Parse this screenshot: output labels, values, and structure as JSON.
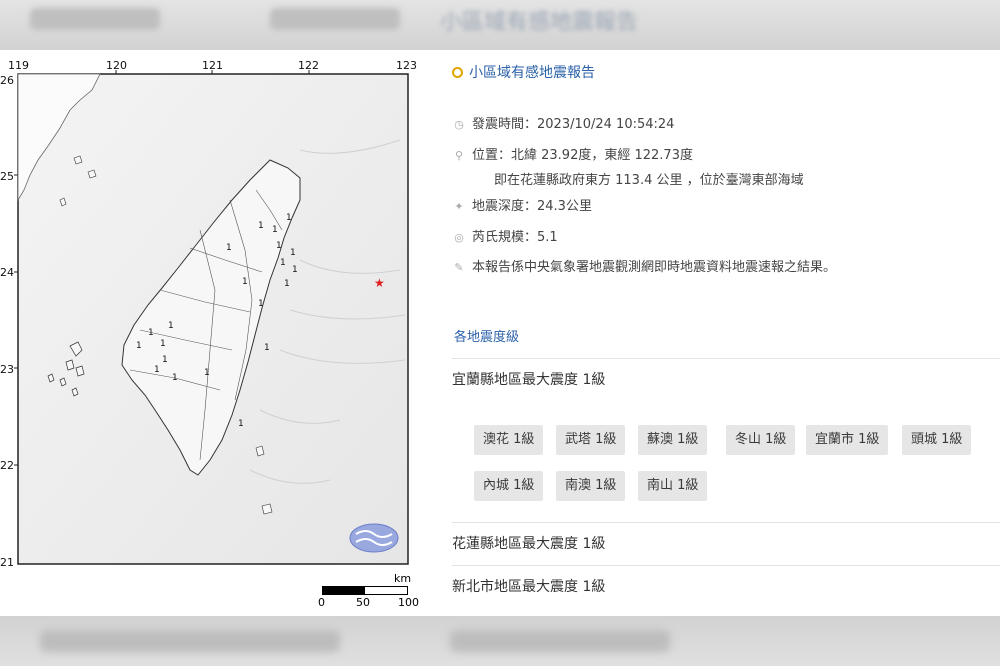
{
  "report": {
    "title": "小區域有感地震報告",
    "time": "發震時間：2023/10/24 10:54:24",
    "location": "位置：北緯 23.92度，東經 122.73度",
    "location_detail": "即在花蓮縣政府東方 113.4 公里 ，位於臺灣東部海域",
    "depth": "地震深度：24.3公里",
    "magnitude": "芮氏規模：5.1",
    "note": "本報告係中央氣象署地震觀測網即時地震資料地震速報之結果。",
    "section_label": "各地震度級",
    "regions": [
      {
        "label": "宜蘭縣地區最大震度 1級",
        "stations": [
          "澳花 1級",
          "武塔 1級",
          "蘇澳 1級",
          "冬山 1級",
          "宜蘭市 1級",
          "頭城 1級",
          "內城 1級",
          "南澳 1級",
          "南山 1級"
        ]
      },
      {
        "label": "花蓮縣地區最大震度 1級",
        "stations": []
      },
      {
        "label": "新北市地區最大震度 1級",
        "stations": []
      }
    ]
  },
  "map": {
    "lon_labels": [
      "119",
      "120",
      "121",
      "122",
      "123"
    ],
    "lat_labels": [
      "26",
      "25",
      "24",
      "23",
      "22",
      "21"
    ],
    "intensity_marker": "1",
    "scale": {
      "unit": "km",
      "ticks": [
        "0",
        "50",
        "100"
      ]
    },
    "epicenter_color": "#e02020"
  },
  "backdrop": {
    "blur_title": "小區域有感地震報告"
  }
}
